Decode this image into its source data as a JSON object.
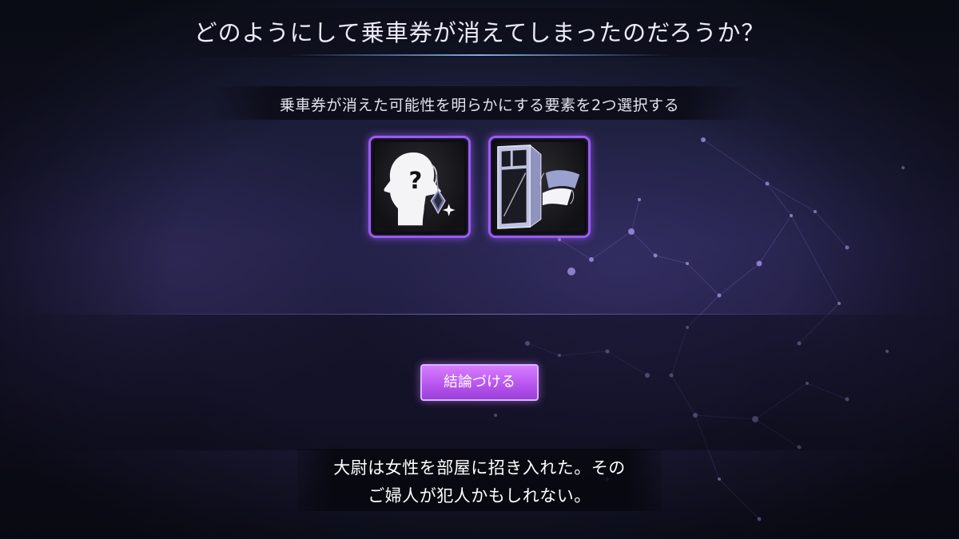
{
  "question": {
    "text": "どのようにして乗車券が消えてしまったのだろうか？"
  },
  "instruction": {
    "text": "乗車券が消えた可能性を明らかにする要素を2つ選択する"
  },
  "clue_cards": [
    {
      "icon": "mystery-woman-earring-icon",
      "selected": true
    },
    {
      "icon": "open-window-ticket-icon",
      "selected": true
    }
  ],
  "conclude_button": {
    "label": "結論づける"
  },
  "subtitle": {
    "lines": [
      "大尉は女性を部屋に招き入れた。その",
      "ご婦人が犯人かもしれない。"
    ]
  },
  "colors": {
    "card_border": "#9a5cf0",
    "button_fill": "#c465f5",
    "background": "#1f1d3e"
  }
}
